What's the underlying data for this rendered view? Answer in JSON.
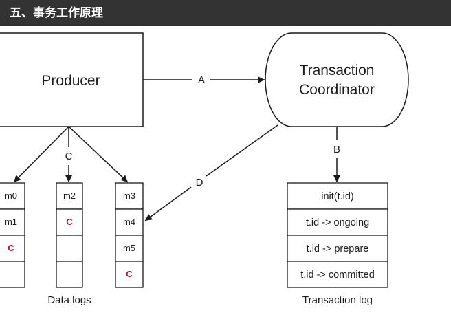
{
  "header": {
    "title": "五、事务工作原理"
  },
  "diagram": {
    "producer": "Producer",
    "coordinator": [
      "Transaction",
      "Coordinator"
    ],
    "edges": {
      "a": "A",
      "b": "B",
      "c": "C",
      "d": "D"
    },
    "data_logs": {
      "caption": "Data logs",
      "columns": [
        [
          "m0",
          "m1",
          "C",
          ""
        ],
        [
          "m2",
          "C",
          "",
          ""
        ],
        [
          "m3",
          "m4",
          "m5",
          "C"
        ]
      ]
    },
    "transaction_log": {
      "caption": "Transaction log",
      "entries": [
        "init(t.id)",
        "t.id -> ongoing",
        "t.id -> prepare",
        "t.id -> committed"
      ]
    }
  }
}
